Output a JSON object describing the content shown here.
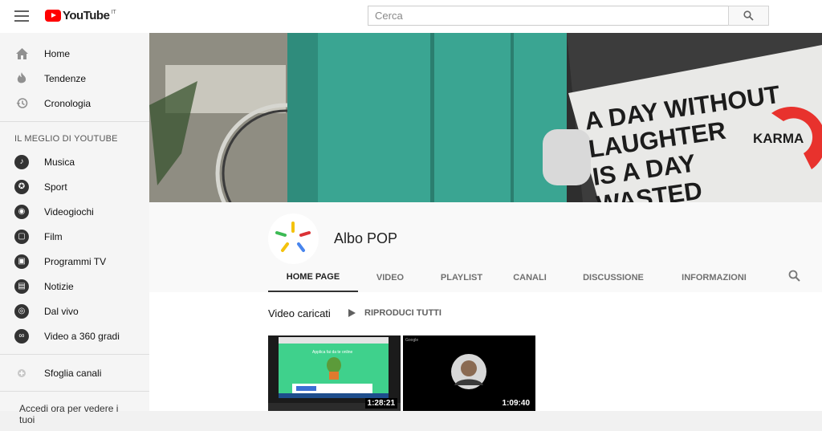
{
  "header": {
    "logo_text": "YouTube",
    "logo_country": "IT",
    "search_placeholder": "Cerca"
  },
  "sidebar": {
    "main": [
      {
        "label": "Home",
        "icon": "home-icon"
      },
      {
        "label": "Tendenze",
        "icon": "flame-icon"
      },
      {
        "label": "Cronologia",
        "icon": "history-icon"
      }
    ],
    "best_title": "IL MEGLIO DI YOUTUBE",
    "best": [
      {
        "label": "Musica",
        "icon": "music-icon"
      },
      {
        "label": "Sport",
        "icon": "sport-icon"
      },
      {
        "label": "Videogiochi",
        "icon": "gaming-icon"
      },
      {
        "label": "Film",
        "icon": "film-icon"
      },
      {
        "label": "Programmi TV",
        "icon": "tv-icon"
      },
      {
        "label": "Notizie",
        "icon": "news-icon"
      },
      {
        "label": "Dal vivo",
        "icon": "live-icon"
      },
      {
        "label": "Video a 360 gradi",
        "icon": "vr-icon"
      }
    ],
    "browse_channels": "Sfoglia canali",
    "signin_text": "Accedi ora per vedere i tuoi"
  },
  "banner": {
    "sign_line1": "A DAY WITHOUT",
    "sign_line2": "LAUGHTER",
    "sign_line3": "IS A DAY",
    "sign_line4": "WASTED",
    "karma": "KARMA"
  },
  "channel": {
    "name": "Albo POP",
    "tabs": [
      "HOME PAGE",
      "VIDEO",
      "PLAYLIST",
      "CANALI",
      "DISCUSSIONE",
      "INFORMAZIONI"
    ]
  },
  "shelf": {
    "title": "Video caricati",
    "play_all": "RIPRODUCI TUTTI",
    "videos": [
      {
        "duration": "1:28:21",
        "subtitle": "Applica fai da te online"
      },
      {
        "duration": "1:09:40",
        "subtitle": "Google"
      }
    ]
  },
  "colors": {
    "brand_red": "#ff0000",
    "wall_teal": "#3aa592",
    "karma_red": "#e8322d"
  }
}
